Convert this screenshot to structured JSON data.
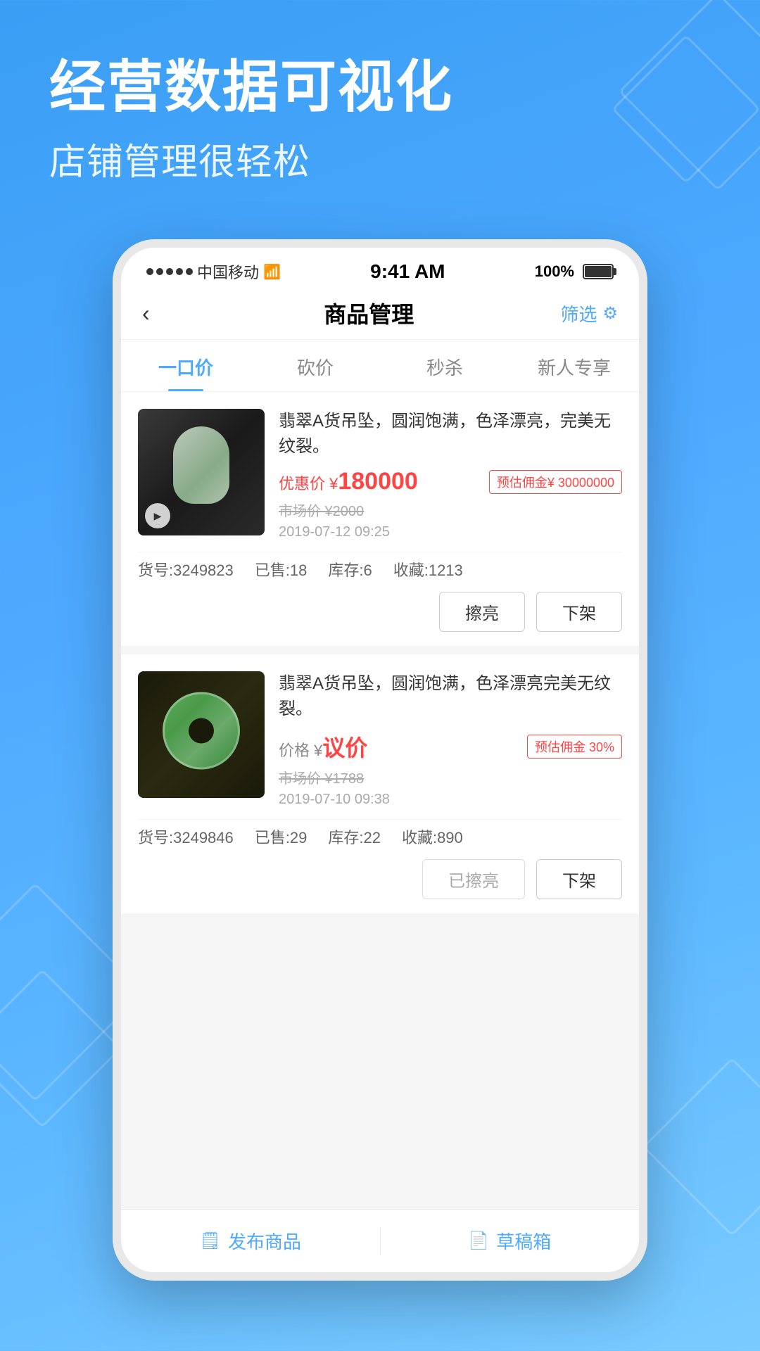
{
  "page": {
    "background_gradient_start": "#3a9ef5",
    "background_gradient_end": "#7acbff"
  },
  "header": {
    "main_title": "经营数据可视化",
    "sub_title": "店铺管理很轻松"
  },
  "phone": {
    "status_bar": {
      "signal": "●●●●●",
      "carrier": "中国移动",
      "time": "9:41 AM",
      "battery": "100%"
    },
    "nav": {
      "back_label": "‹",
      "title": "商品管理",
      "filter_label": "筛选",
      "filter_icon": "≡"
    },
    "tabs": [
      {
        "id": "yikoujia",
        "label": "一口价",
        "active": true
      },
      {
        "id": "shanjia",
        "label": "砍价",
        "active": false
      },
      {
        "id": "miaosha",
        "label": "秒杀",
        "active": false
      },
      {
        "id": "xinren",
        "label": "新人专享",
        "active": false
      }
    ],
    "products": [
      {
        "id": 1,
        "name": "翡翠A货吊坠，圆润饱满，色泽漂亮，完美无纹裂。",
        "price_label": "优惠价 ¥",
        "price_value": "180000",
        "estimate_label": "预估佣金¥ 30000000",
        "market_price": "市场价 ¥2000",
        "date": "2019-07-12 09:25",
        "item_no_label": "货号:",
        "item_no": "3249823",
        "sold_label": "已售:",
        "sold": "18",
        "stock_label": "库存:",
        "stock": "6",
        "collect_label": "收藏:",
        "collect": "1213",
        "btn_polish": "擦亮",
        "btn_delist": "下架",
        "polish_active": true
      },
      {
        "id": 2,
        "name": "翡翠A货吊坠，圆润饱满，色泽漂亮完美无纹裂。",
        "price_label": "价格 ¥",
        "price_value": "议价",
        "estimate_label": "预估佣金 30%",
        "market_price": "市场价 ¥1788",
        "date": "2019-07-10 09:38",
        "item_no_label": "货号:",
        "item_no": "3249846",
        "sold_label": "已售:",
        "sold": "29",
        "stock_label": "库存:",
        "stock": "22",
        "collect_label": "收藏:",
        "collect": "890",
        "btn_polish": "已擦亮",
        "btn_delist": "下架",
        "polish_active": false
      }
    ],
    "bottom": {
      "publish_icon": "□",
      "publish_label": "发布商品",
      "draft_icon": "□",
      "draft_label": "草稿箱"
    }
  }
}
